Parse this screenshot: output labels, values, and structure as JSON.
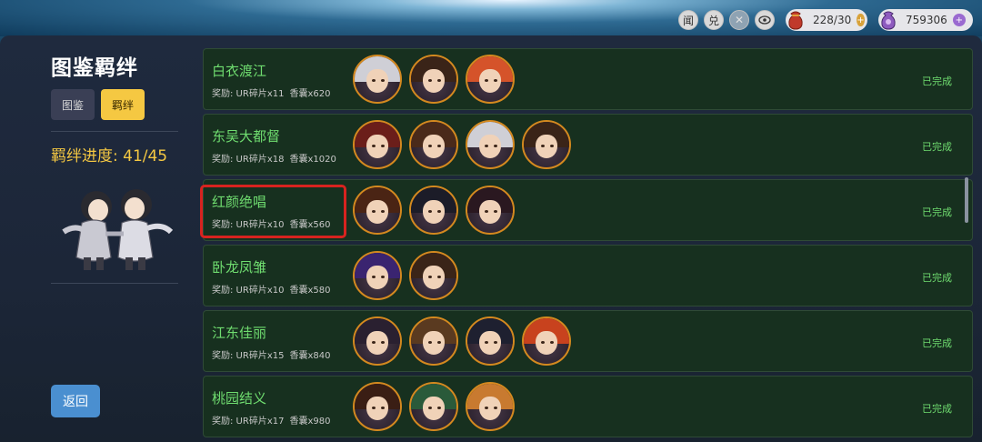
{
  "topbar": {
    "btn_wen": "闻",
    "btn_dui": "兑",
    "resource_1": {
      "value": "228/30",
      "icon": "pouch-icon",
      "color": "#c0392b"
    },
    "resource_2": {
      "value": "759306",
      "icon": "gem-bag-icon",
      "color": "#8e5bbf"
    }
  },
  "sidebar": {
    "title": "图鉴羁绊",
    "tabs": [
      {
        "label": "图鉴",
        "active": false
      },
      {
        "label": "羁绊",
        "active": true
      }
    ],
    "progress": "羁绊进度: 41/45",
    "back_label": "返回"
  },
  "bonds": [
    {
      "name": "白衣渡江",
      "reward_a": "奖励: UR碎片x11",
      "reward_b": "香囊x620",
      "status": "已完成",
      "avatars": [
        {
          "hair": "#cfcfd6"
        },
        {
          "hair": "#3a2418"
        },
        {
          "hair": "#d5532a"
        }
      ]
    },
    {
      "name": "东吴大都督",
      "reward_a": "奖励: UR碎片x18",
      "reward_b": "香囊x1020",
      "status": "已完成",
      "avatars": [
        {
          "hair": "#6b1e1a"
        },
        {
          "hair": "#4a2a1a"
        },
        {
          "hair": "#cfcfd6"
        },
        {
          "hair": "#3a2418"
        }
      ]
    },
    {
      "name": "红颜绝唱",
      "reward_a": "奖励: UR碎片x10",
      "reward_b": "香囊x560",
      "status": "已完成",
      "avatars": [
        {
          "hair": "#4a2414"
        },
        {
          "hair": "#1c1c28"
        },
        {
          "hair": "#2a1820"
        }
      ]
    },
    {
      "name": "卧龙凤雏",
      "reward_a": "奖励: UR碎片x10",
      "reward_b": "香囊x580",
      "status": "已完成",
      "avatars": [
        {
          "hair": "#3a2470"
        },
        {
          "hair": "#3a2418"
        }
      ]
    },
    {
      "name": "江东佳丽",
      "reward_a": "奖励: UR碎片x15",
      "reward_b": "香囊x840",
      "status": "已完成",
      "avatars": [
        {
          "hair": "#2a2030"
        },
        {
          "hair": "#5a3a20"
        },
        {
          "hair": "#1e2030"
        },
        {
          "hair": "#c8421e"
        }
      ]
    },
    {
      "name": "桃园结义",
      "reward_a": "奖励: UR碎片x17",
      "reward_b": "香囊x980",
      "status": "已完成",
      "avatars": [
        {
          "hair": "#3a1e14"
        },
        {
          "hair": "#2a5a3a"
        },
        {
          "hair": "#c87a30"
        }
      ]
    }
  ],
  "highlighted_bond": "红颜绝唱",
  "colors": {
    "accent": "#f5c842",
    "complete": "#6fdc6f",
    "highlight": "#d8231f",
    "back_button": "#4a8fd0"
  }
}
